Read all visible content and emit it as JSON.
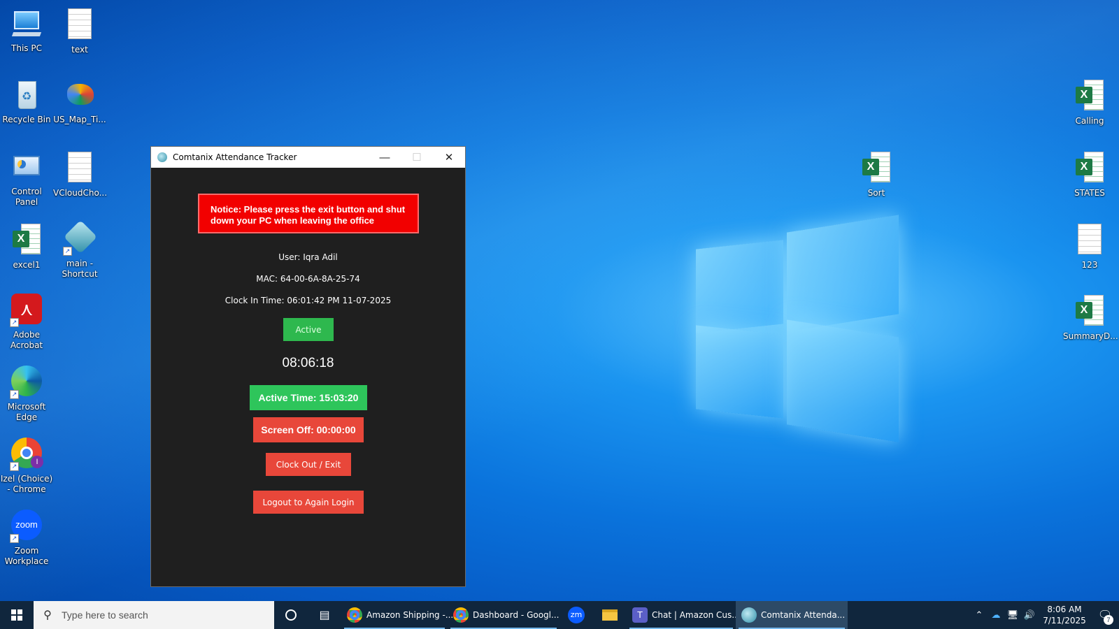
{
  "desktop": {
    "icons_left": [
      {
        "label": "This PC",
        "icon": "computer-icon"
      },
      {
        "label": "text",
        "icon": "text-document-icon"
      },
      {
        "label": "Recycle Bin",
        "icon": "recycle-bin-icon"
      },
      {
        "label": "US_Map_Ti...",
        "icon": "image-file-icon"
      },
      {
        "label": "Control Panel",
        "icon": "control-panel-icon"
      },
      {
        "label": "VCloudCho...",
        "icon": "text-document-icon"
      },
      {
        "label": "excel1",
        "icon": "excel-file-icon"
      },
      {
        "label": "main - Shortcut",
        "icon": "app-shortcut-icon"
      },
      {
        "label": "Adobe Acrobat",
        "icon": "adobe-acrobat-icon"
      },
      {
        "label": "Microsoft Edge",
        "icon": "edge-icon"
      },
      {
        "label": "Izel (Choice) - Chrome",
        "icon": "chrome-icon"
      },
      {
        "label": "Zoom Workplace",
        "icon": "zoom-icon"
      }
    ],
    "icons_right": [
      {
        "label": "Calling",
        "icon": "excel-file-icon"
      },
      {
        "label": "Sort",
        "icon": "excel-file-icon"
      },
      {
        "label": "STATES",
        "icon": "excel-file-icon"
      },
      {
        "label": "123",
        "icon": "text-document-icon"
      },
      {
        "label": "SummaryD...",
        "icon": "excel-file-icon"
      }
    ]
  },
  "window": {
    "title": "Comtanix Attendance Tracker",
    "notice": "Notice: Please press the exit button and shut down your PC when leaving the office",
    "user": "User: Iqra Adil",
    "mac": "MAC: 64-00-6A-8A-25-74",
    "clock_in": "Clock In Time: 06:01:42 PM 11-07-2025",
    "status_label": "Active",
    "clock": "08:06:18",
    "active_time": "Active Time: 15:03:20",
    "screen_off": "Screen Off: 00:00:00",
    "clock_out_label": "Clock Out / Exit",
    "logout_label": "Logout to Again Login",
    "colors": {
      "notice": "#f20000",
      "active": "#2ec55b",
      "danger": "#e8473a",
      "background": "#1f1f1f"
    }
  },
  "taskbar": {
    "search_placeholder": "Type here to search",
    "tasks": [
      {
        "label": "Amazon Shipping -...",
        "icon": "chrome-icon"
      },
      {
        "label": "Dashboard - Googl...",
        "icon": "chrome-icon"
      },
      {
        "label": "",
        "icon": "zoom-icon"
      },
      {
        "label": "",
        "icon": "file-explorer-icon"
      },
      {
        "label": "Chat | Amazon Cus...",
        "icon": "teams-icon"
      },
      {
        "label": "Comtanix Attenda...",
        "icon": "comtanix-icon"
      }
    ],
    "zoom_text": "zm",
    "time": "8:06 AM",
    "date": "7/11/2025",
    "notification_count": "7"
  }
}
